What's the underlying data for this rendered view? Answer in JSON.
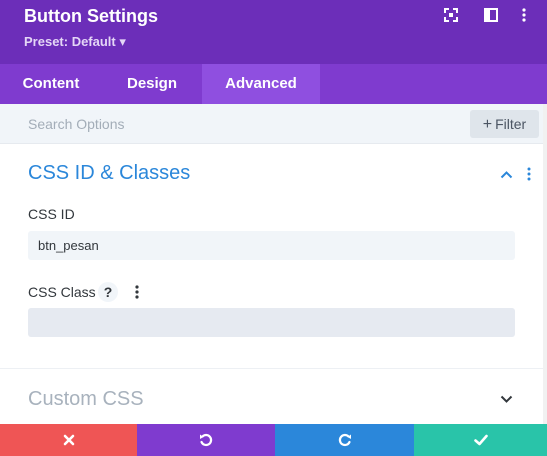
{
  "header": {
    "title": "Button Settings",
    "preset_label": "Preset: Default ▾",
    "icons": [
      "expand-icon",
      "split-view-icon",
      "more-vertical-icon"
    ]
  },
  "tabs": [
    {
      "label": "Content"
    },
    {
      "label": "Design"
    },
    {
      "label": "Advanced",
      "active": true
    }
  ],
  "search": {
    "placeholder": "Search Options",
    "filter_label": "Filter"
  },
  "sections": {
    "css_id_classes": {
      "title": "CSS ID & Classes",
      "css_id_label": "CSS ID",
      "css_id_value": "btn_pesan",
      "css_class_label": "CSS Class",
      "help_glyph": "?",
      "css_class_value": ""
    },
    "custom_css": {
      "title": "Custom CSS"
    }
  },
  "footer": {
    "buttons": [
      "cancel",
      "undo",
      "redo",
      "save"
    ]
  },
  "colors": {
    "header_bg": "#6c2eb9",
    "tabs_bg": "#7f3bcf",
    "active_tab": "#8f4fe0",
    "accent_blue": "#2b87da",
    "cancel": "#ef5555",
    "undo": "#7f3bcf",
    "redo": "#2b87da",
    "save": "#29c4a9"
  }
}
